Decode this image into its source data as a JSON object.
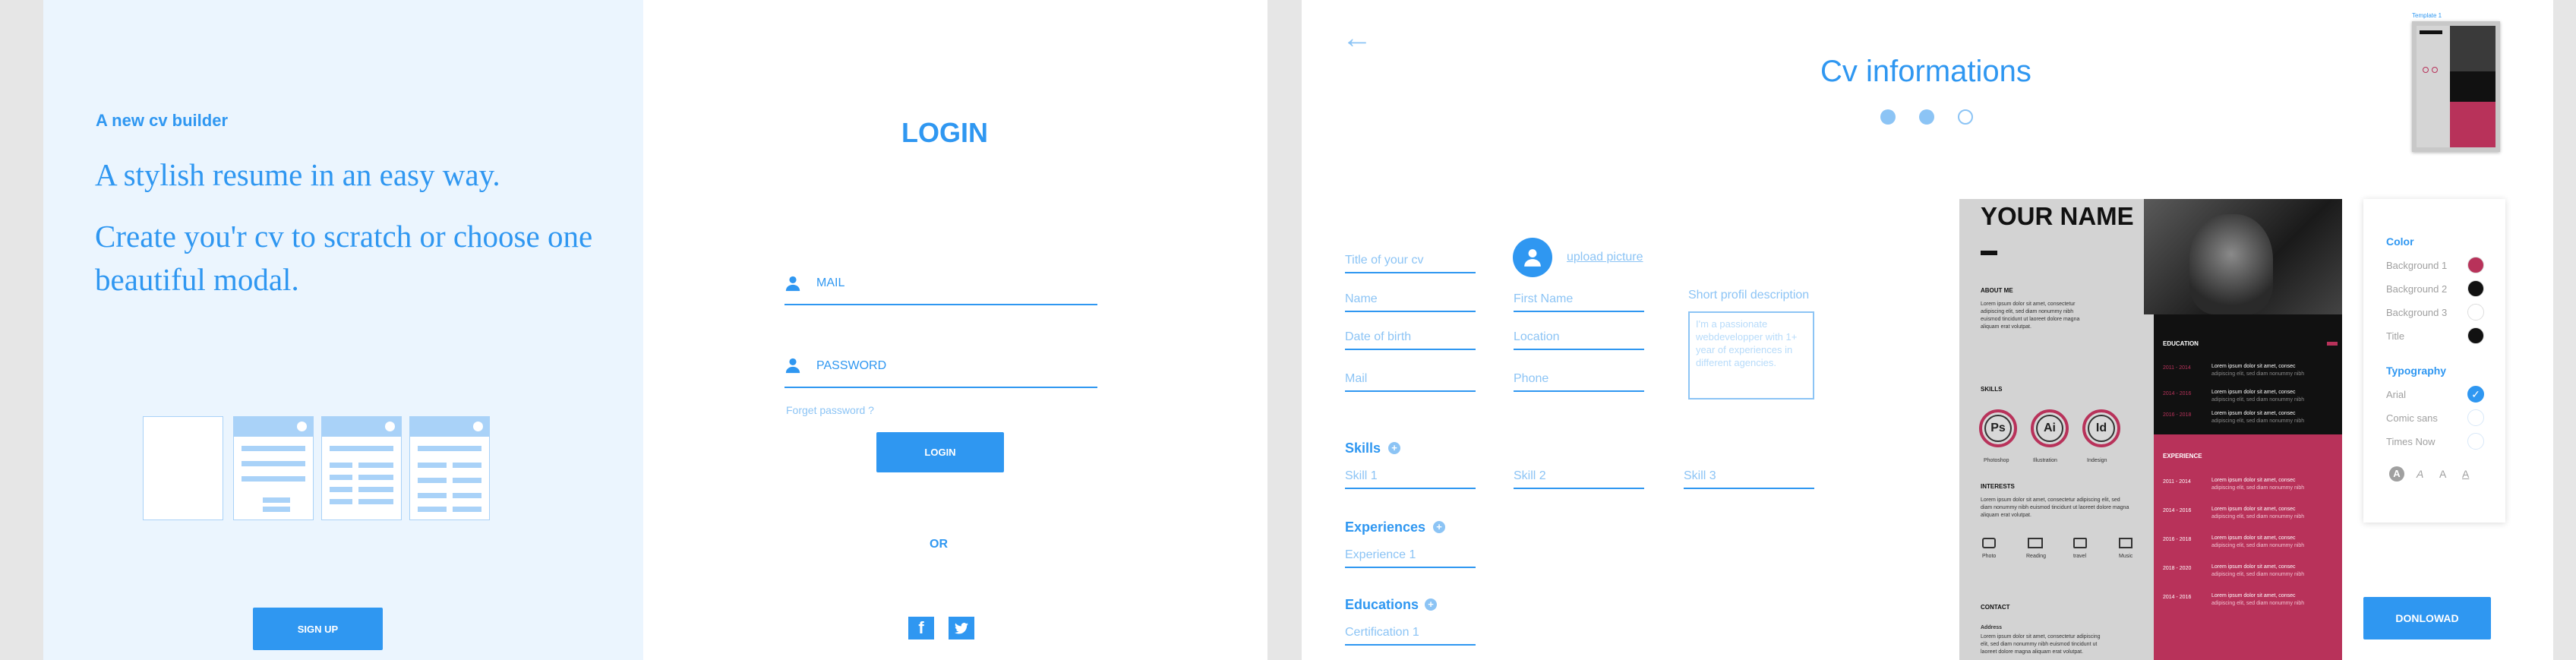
{
  "intro": {
    "kicker": "A new cv builder",
    "headline1": "A stylish resume in an easy way.",
    "headline2": "Create you'r cv to scratch or choose one beautiful modal.",
    "signup_label": "SIGN UP"
  },
  "login": {
    "title": "LOGIN",
    "mail_label": "MAIL",
    "password_label": "PASSWORD",
    "forgot_label": "Forget password ?",
    "login_label": "LOGIN",
    "or_label": "OR",
    "facebook_glyph": "f",
    "twitter_glyph": "🐦"
  },
  "cv": {
    "back_glyph": "←",
    "title": "Cv informations",
    "template_label": "Template 1",
    "steps": [
      {
        "label": "step-1",
        "active": true
      },
      {
        "label": "step-2",
        "active": true
      },
      {
        "label": "step-3",
        "active": false
      }
    ],
    "upload_label": "upload picture",
    "fields": {
      "title": "Title of your cv",
      "name": "Name",
      "first_name": "First Name",
      "dob": "Date of birth",
      "location": "Location",
      "mail": "Mail",
      "phone": "Phone",
      "short_profile_label": "Short profil description",
      "short_profile_placeholder": "I'm a passionate webdevelopper  with 1+ year of experiences in different agencies."
    },
    "skills": {
      "label": "Skills",
      "items": [
        "Skill 1",
        "Skill 2",
        "Skill 3"
      ]
    },
    "experiences": {
      "label": "Experiences",
      "items": [
        "Experience 1"
      ]
    },
    "educations": {
      "label": "Educations",
      "items": [
        "Certification 1"
      ]
    },
    "download_label": "DONLOWAD"
  },
  "preview": {
    "name": "YOUR NAME",
    "about_title": "ABOUT ME",
    "lorem": "Lorem ipsum dolor sit amet, consectetur adipiscing elit, sed diam nonummy nibh euismod tincidunt ut laoreet dolore magna aliquam erat volutpat.",
    "skills_title": "SKILLS",
    "skills": [
      {
        "abbr": "Ps",
        "name": "Photoshop"
      },
      {
        "abbr": "Ai",
        "name": "Illustration"
      },
      {
        "abbr": "Id",
        "name": "Indesign"
      }
    ],
    "interests_title": "INTERESTS",
    "interests": [
      "Photo",
      "Reading",
      "travel",
      "Music"
    ],
    "contact_title": "CONTACT",
    "address_label": "Address",
    "education_title": "EDUCATION",
    "experience_title": "EXPERIENCE",
    "dates": [
      "2011 - 2014",
      "2014 - 2016",
      "2016 - 2018"
    ],
    "exp_dates": [
      "2011 - 2014",
      "2014 - 2016",
      "2016 - 2018",
      "2018 - 2020",
      "2014 - 2016"
    ],
    "entry_title": "Lorem ipsum dolor sit amet, consec",
    "entry_sub": "adipiscing elit, sed diam nonummy nibh"
  },
  "settings": {
    "color_title": "Color",
    "colors": [
      {
        "label": "Background 1",
        "hex": "#b8325a"
      },
      {
        "label": "Background 2",
        "hex": "#111111"
      },
      {
        "label": "Background 3",
        "hex": "#ffffff"
      },
      {
        "label": "Title",
        "hex": "#111111"
      }
    ],
    "typo_title": "Typography",
    "fonts": [
      {
        "label": "Arial",
        "selected": true
      },
      {
        "label": "Comic sans",
        "selected": false
      },
      {
        "label": "Times Now",
        "selected": false
      }
    ],
    "font_style_glyphs": [
      "A",
      "A",
      "A",
      "A"
    ]
  }
}
